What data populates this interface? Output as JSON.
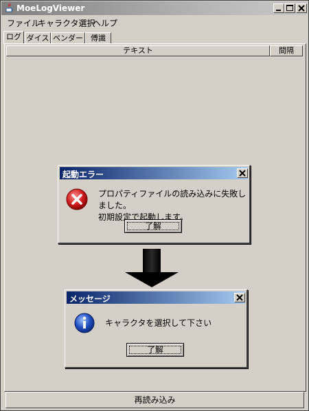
{
  "window": {
    "title": "MoeLogViewer",
    "menu": [
      "ファイル",
      "キャラクタ選択",
      "ヘルプ"
    ]
  },
  "tabs": [
    "ログ",
    "ダイス",
    "ベンダー",
    "傅識"
  ],
  "table": {
    "columns": [
      "テキスト",
      "間隔"
    ]
  },
  "reload_label": "再読み込み",
  "error_dialog": {
    "title": "起動エラー",
    "message_line1": "プロパティファイルの読み込みに失敗しました。",
    "message_line2": "初期設定で起動します。",
    "ok_label": "了解",
    "icon": "error-icon"
  },
  "message_dialog": {
    "title": "メッセージ",
    "message": "キャラクタを選択して下さい",
    "ok_label": "了解",
    "icon": "info-icon"
  },
  "colors": {
    "dialog_title_start": "#0a246a",
    "dialog_title_end": "#a6caf0",
    "face": "#d4d0c8"
  }
}
